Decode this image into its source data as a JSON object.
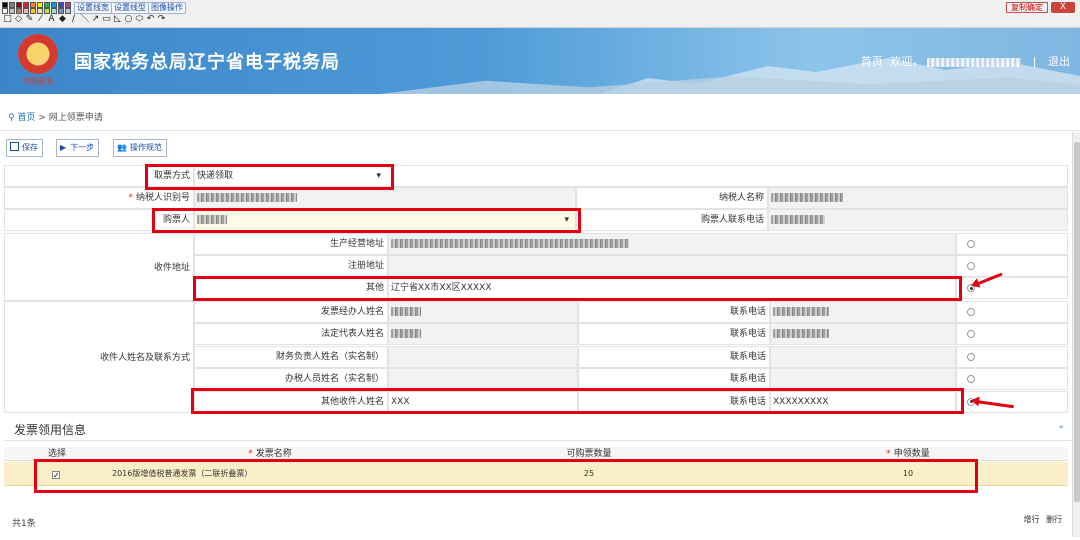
{
  "paint": {
    "colors": [
      "#000000",
      "#7f7f7f",
      "#880015",
      "#ed1c24",
      "#ff7f27",
      "#fff200",
      "#22b14c",
      "#00a2e8",
      "#3f48cc",
      "#a349a4",
      "#ffffff",
      "#c3c3c3",
      "#b97a57",
      "#ffaec9",
      "#ffc90e",
      "#efe4b0",
      "#b5e61d",
      "#99d9ea",
      "#7092be",
      "#c8bfe7"
    ],
    "links": [
      "设置线宽",
      "设置线型",
      "图像操作"
    ],
    "tools": [
      "□",
      "◇",
      "✎",
      "⁄",
      "A",
      "◆",
      "/",
      "＼",
      "↗",
      "▭",
      "◺",
      "○",
      "⬭",
      "↶",
      "↷"
    ],
    "copy_label": "复制确定",
    "close_label": "X"
  },
  "header": {
    "title": "国家税务总局辽宁省电子税务局",
    "emblem_caption": "中国税务",
    "nav_home": "首页",
    "nav_welcome": "欢迎，",
    "nav_sep": "|",
    "nav_logout": "退出"
  },
  "breadcrumb": {
    "home": "首页",
    "sep": ">",
    "current": "网上领票申请"
  },
  "actions": {
    "save": "保存",
    "next": "下一步",
    "guide": "操作规范"
  },
  "form": {
    "pickup_label": "取票方式",
    "pickup_value": "快递领取",
    "taxpayer_id_label": "纳税人识别号",
    "taxpayer_name_label": "纳税人名称",
    "buyer_label": "购票人",
    "buyer_phone_label": "购票人联系电话",
    "address_group_label": "收件地址",
    "address_rows": [
      {
        "label": "生产经营地址",
        "value": ""
      },
      {
        "label": "注册地址",
        "value": ""
      },
      {
        "label": "其他",
        "value": "辽宁省XX市XX区XXXXX"
      }
    ],
    "contact_group_label": "收件人姓名及联系方式",
    "contact_rows": [
      {
        "label": "发票经办人姓名",
        "phone_label": "联系电话",
        "name": "",
        "phone": ""
      },
      {
        "label": "法定代表人姓名",
        "phone_label": "联系电话",
        "name": "",
        "phone": ""
      },
      {
        "label": "财务负责人姓名（实名制）",
        "phone_label": "联系电话",
        "name": "",
        "phone": ""
      },
      {
        "label": "办税人员姓名（实名制）",
        "phone_label": "联系电话",
        "name": "",
        "phone": ""
      },
      {
        "label": "其他收件人姓名",
        "phone_label": "联系电话",
        "name": "XXX",
        "phone": "XXXXXXXXX"
      }
    ]
  },
  "invoice": {
    "section_title": "发票领用信息",
    "columns": [
      "选择",
      "发票名称",
      "可购票数量",
      "申领数量"
    ],
    "rows": [
      {
        "name": "2016版增值税普通发票（二联折叠票）",
        "available": "25",
        "quantity": "10",
        "checked": true
      }
    ],
    "count_label": "共1条",
    "add_row": "增行",
    "del_row": "删行"
  }
}
